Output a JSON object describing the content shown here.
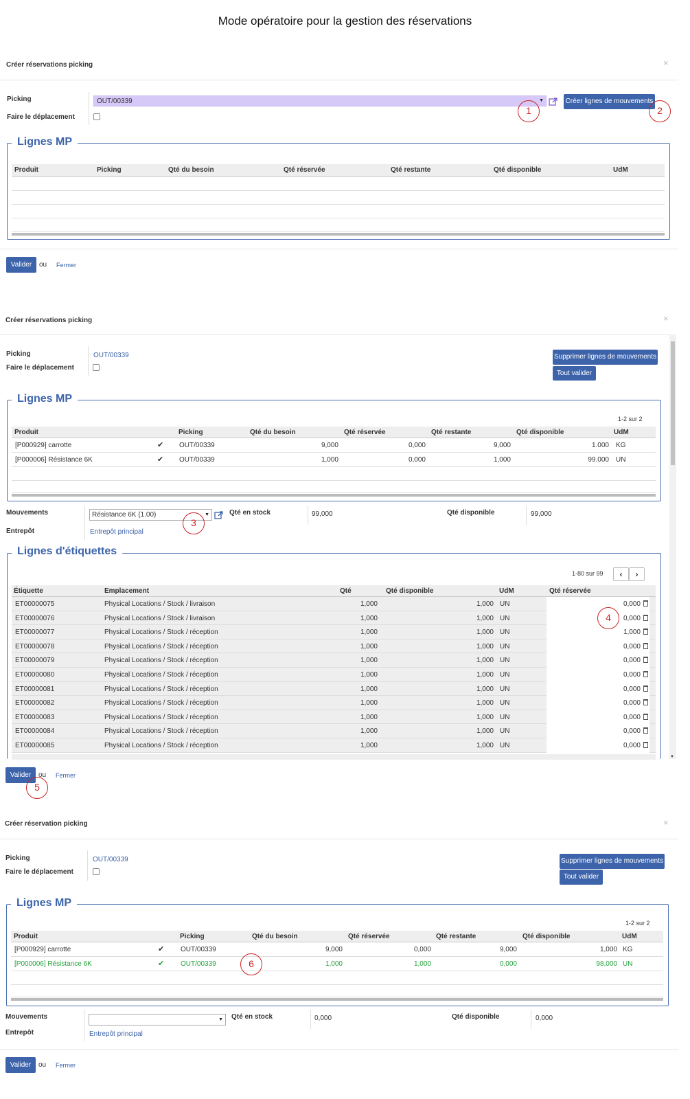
{
  "page_title": "Mode opératoire pour la gestion des réservations",
  "common": {
    "ou": "ou",
    "fermer": "Fermer",
    "valider": "Valider",
    "close_glyph": "×",
    "lbl_picking": "Picking",
    "lbl_faire": "Faire le déplacement",
    "legend_mp": "Lignes MP",
    "legend_etiq": "Lignes d'étiquettes",
    "lbl_mouvements": "Mouvements",
    "lbl_entrepot": "Entrepôt",
    "lbl_qte_stock": "Qté en stock",
    "lbl_qte_dispo": "Qté disponible",
    "entrepot_value": "Entrepôt principal",
    "btn_supprimer": "Supprimer lignes de mouvements",
    "btn_tout_valider": "Tout valider",
    "btn_creer_lignes": "Créer lignes de mouvements"
  },
  "mp_headers": [
    "Produit",
    "Picking",
    "Qté du besoin",
    "Qté réservée",
    "Qté restante",
    "Qté disponible",
    "UdM"
  ],
  "etiq_headers": [
    "Étiquette",
    "Emplacement",
    "Qté",
    "Qté disponible",
    "UdM",
    "Qté réservée"
  ],
  "dialog1": {
    "title": "Créer réservations picking",
    "picking_value": "OUT/00339",
    "accent_color": "#d6c8f7"
  },
  "dialog2": {
    "title": "Créer réservations picking",
    "picking_value": "OUT/00339",
    "pager": "1-2 sur 2",
    "mp_rows": [
      {
        "produit": "[P000929] carrotte",
        "picking": "OUT/00339",
        "besoin": "9,000",
        "reservee": "0,000",
        "restante": "9,000",
        "dispo": "1.000",
        "udm": "KG"
      },
      {
        "produit": "[P000006] Résistance 6K",
        "picking": "OUT/00339",
        "besoin": "1,000",
        "reservee": "0,000",
        "restante": "1,000",
        "dispo": "99.000",
        "udm": "UN"
      }
    ],
    "mouvement_value": "Résistance 6K (1.00)",
    "qte_stock": "99,000",
    "qte_dispo": "99,000",
    "etiq_pager": "1-80 sur 99",
    "etiq_rows": [
      {
        "etiq": "ET00000075",
        "empl": "Physical Locations / Stock / livraison",
        "qte": "1,000",
        "dispo": "1,000",
        "udm": "UN",
        "res": "0,000"
      },
      {
        "etiq": "ET00000076",
        "empl": "Physical Locations / Stock / livraison",
        "qte": "1,000",
        "dispo": "1,000",
        "udm": "UN",
        "res": "0,000"
      },
      {
        "etiq": "ET00000077",
        "empl": "Physical Locations / Stock / réception",
        "qte": "1,000",
        "dispo": "1,000",
        "udm": "UN",
        "res": "1,000"
      },
      {
        "etiq": "ET00000078",
        "empl": "Physical Locations / Stock / réception",
        "qte": "1,000",
        "dispo": "1,000",
        "udm": "UN",
        "res": "0,000"
      },
      {
        "etiq": "ET00000079",
        "empl": "Physical Locations / Stock / réception",
        "qte": "1,000",
        "dispo": "1,000",
        "udm": "UN",
        "res": "0,000"
      },
      {
        "etiq": "ET00000080",
        "empl": "Physical Locations / Stock / réception",
        "qte": "1,000",
        "dispo": "1,000",
        "udm": "UN",
        "res": "0,000"
      },
      {
        "etiq": "ET00000081",
        "empl": "Physical Locations / Stock / réception",
        "qte": "1,000",
        "dispo": "1,000",
        "udm": "UN",
        "res": "0,000"
      },
      {
        "etiq": "ET00000082",
        "empl": "Physical Locations / Stock / réception",
        "qte": "1,000",
        "dispo": "1,000",
        "udm": "UN",
        "res": "0,000"
      },
      {
        "etiq": "ET00000083",
        "empl": "Physical Locations / Stock / réception",
        "qte": "1,000",
        "dispo": "1,000",
        "udm": "UN",
        "res": "0,000"
      },
      {
        "etiq": "ET00000084",
        "empl": "Physical Locations / Stock / réception",
        "qte": "1,000",
        "dispo": "1,000",
        "udm": "UN",
        "res": "0,000"
      },
      {
        "etiq": "ET00000085",
        "empl": "Physical Locations / Stock / réception",
        "qte": "1,000",
        "dispo": "1,000",
        "udm": "UN",
        "res": "0,000"
      }
    ]
  },
  "dialog3": {
    "title": "Créer réservation picking",
    "picking_value": "OUT/00339",
    "pager": "1-2 sur 2",
    "mp_rows": [
      {
        "produit": "[P000929] carrotte",
        "picking": "OUT/00339",
        "besoin": "9,000",
        "reservee": "0,000",
        "restante": "9,000",
        "dispo": "1,000",
        "udm": "KG",
        "green": false
      },
      {
        "produit": "[P000006] Résistance 6K",
        "picking": "OUT/00339",
        "besoin": "1,000",
        "reservee": "1,000",
        "restante": "0,000",
        "dispo": "98,000",
        "udm": "UN",
        "green": true
      }
    ],
    "mouvement_value": "",
    "qte_stock": "0,000",
    "qte_dispo": "0,000",
    "green_color": "#23a23a"
  },
  "markers": [
    "1",
    "2",
    "3",
    "4",
    "5",
    "6"
  ]
}
